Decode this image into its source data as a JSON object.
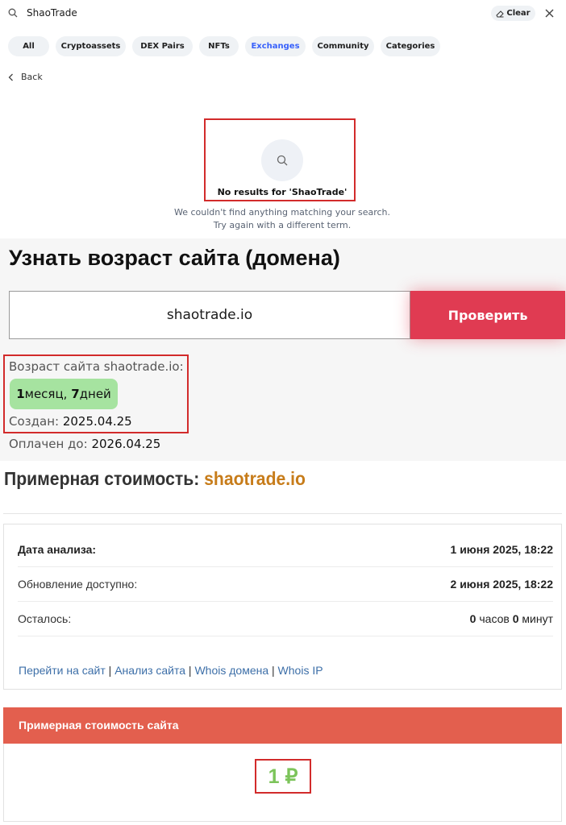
{
  "search": {
    "query": "ShaoTrade",
    "clear_label": "Clear"
  },
  "filters": [
    {
      "label": "All",
      "active": false
    },
    {
      "label": "Cryptoassets",
      "active": false
    },
    {
      "label": "DEX Pairs",
      "active": false
    },
    {
      "label": "NFTs",
      "active": false
    },
    {
      "label": "Exchanges",
      "active": true
    },
    {
      "label": "Community",
      "active": false
    },
    {
      "label": "Categories",
      "active": false
    }
  ],
  "back_label": "Back",
  "no_results": {
    "title": "No results for 'ShaoTrade'",
    "line1": "We couldn't find anything matching your search.",
    "line2": "Try again with a different term."
  },
  "domain_age": {
    "title": "Узнать возраст сайта (домена)",
    "input_value": "shaotrade.io",
    "check_button": "Проверить",
    "age_label": "Возраст сайта shaotrade.io:",
    "age_number_1": "1",
    "age_unit_1": " месяц,",
    "age_number_2": "7",
    "age_unit_2": " дней",
    "created_label": "Создан:",
    "created_value": "2025.04.25",
    "paid_label": "Оплачен до:",
    "paid_value": "2026.04.25"
  },
  "estimate": {
    "title_prefix": "Примерная стоимость:",
    "domain": "shaotrade.io",
    "rows": [
      {
        "label": "Дата анализа:",
        "value": "1 июня 2025, 18:22"
      },
      {
        "label": "Обновление доступно:",
        "value": "2 июня 2025, 18:22"
      },
      {
        "label": "Осталось:",
        "hours": "0",
        "hours_unit": "часов",
        "minutes": "0",
        "minutes_unit": "минут"
      }
    ],
    "links": [
      "Перейти на сайт",
      "Анализ сайта",
      "Whois домена",
      "Whois IP"
    ],
    "site_cost_header": "Примерная стоимость сайта",
    "price": "1 ₽"
  },
  "colors": {
    "accent_blue": "#3861fb",
    "check_button": "#e03b52",
    "age_badge": "#a6e3a0",
    "domain_orange": "#c77c1a",
    "cost_header": "#e35f4e",
    "price_green": "#7cc45a",
    "highlight_red": "#d22b2b"
  }
}
